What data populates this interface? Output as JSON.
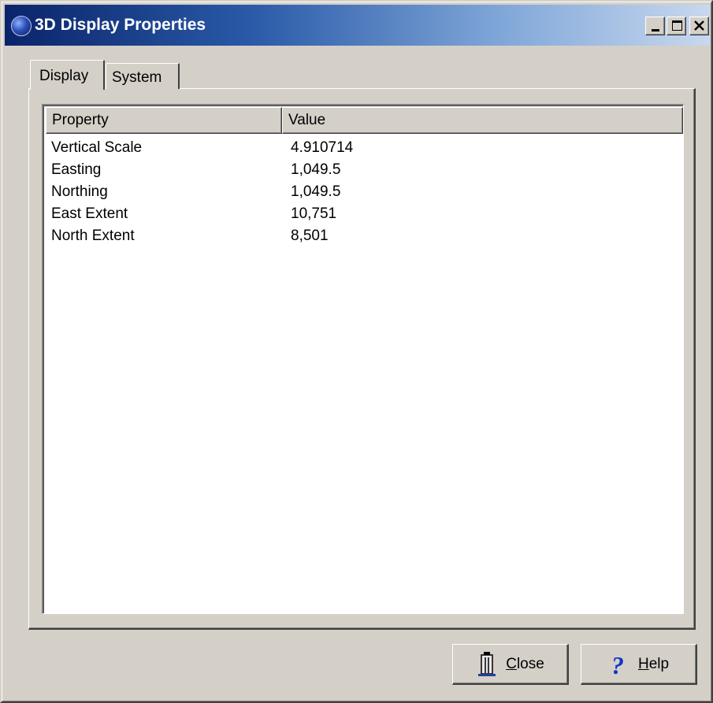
{
  "window": {
    "title": "3D Display Properties",
    "icon": "globe-icon",
    "controls": {
      "minimize": "minimize-icon",
      "maximize": "maximize-icon",
      "close": "close-icon"
    }
  },
  "tabs": [
    {
      "label": "Display",
      "selected": true
    },
    {
      "label": "System",
      "selected": false
    }
  ],
  "table": {
    "columns": [
      "Property",
      "Value"
    ],
    "rows": [
      {
        "property": "Vertical Scale",
        "value": "4.910714"
      },
      {
        "property": "Easting",
        "value": "1,049.5"
      },
      {
        "property": "Northing",
        "value": "1,049.5"
      },
      {
        "property": "East Extent",
        "value": "10,751"
      },
      {
        "property": "North Extent",
        "value": "8,501"
      }
    ]
  },
  "buttons": {
    "close": {
      "accel": "C",
      "rest": "lose",
      "icon": "door-exit-icon"
    },
    "help": {
      "accel": "H",
      "rest": "elp",
      "icon": "question-mark-icon"
    }
  },
  "colors": {
    "titlebar_start": "#0a246a",
    "titlebar_end": "#c8d8ee",
    "face": "#d4d0c8",
    "help_icon": "#1034c8"
  }
}
